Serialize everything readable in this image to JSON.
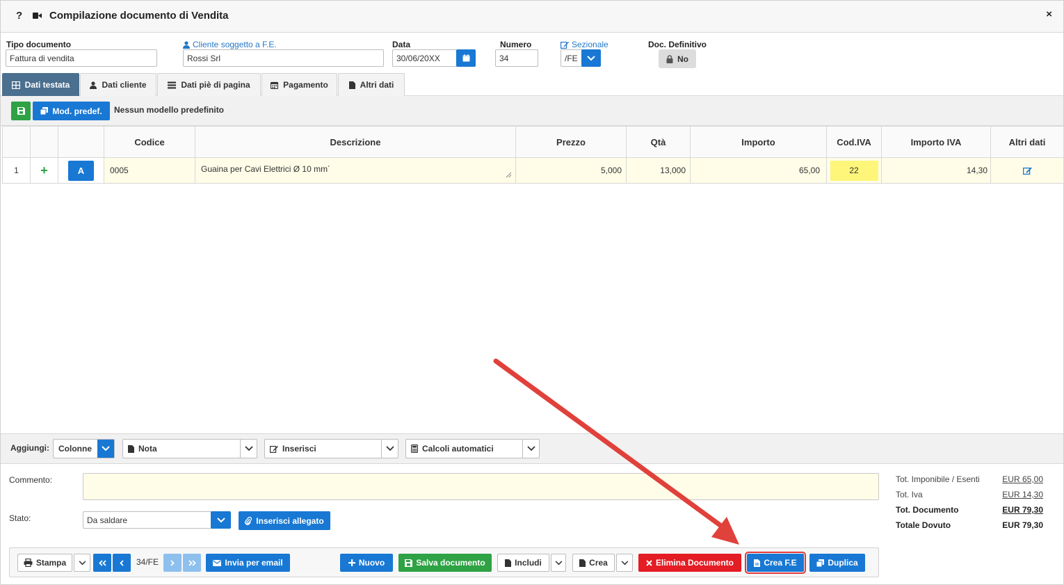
{
  "window": {
    "help": "?",
    "title": "Compilazione documento di Vendita",
    "close": "×"
  },
  "header": {
    "tipo_documento": {
      "label": "Tipo documento",
      "value": "Fattura di vendita"
    },
    "cliente": {
      "label": "Cliente soggetto a F.E.",
      "value": "Rossi Srl"
    },
    "data": {
      "label": "Data",
      "value": "30/06/20XX"
    },
    "numero": {
      "label": "Numero",
      "value": "34"
    },
    "sezionale": {
      "label": "Sezionale",
      "value": "/FE"
    },
    "doc_definitivo": {
      "label": "Doc. Definitivo",
      "value": "No"
    }
  },
  "tabs": [
    {
      "label": "Dati testata",
      "icon": "grid-icon",
      "active": true
    },
    {
      "label": "Dati cliente",
      "icon": "user-icon"
    },
    {
      "label": "Dati piè di pagina",
      "icon": "list-icon"
    },
    {
      "label": "Pagamento",
      "icon": "calendar-icon"
    },
    {
      "label": "Altri dati",
      "icon": "file-icon"
    }
  ],
  "subbar": {
    "mod_predef": "Mod. predef.",
    "modello": "Nessun modello predefinito"
  },
  "grid": {
    "columns": [
      "",
      "",
      "",
      "Codice",
      "Descrizione",
      "Prezzo",
      "Qtà",
      "Importo",
      "Cod.IVA",
      "Importo IVA",
      "Altri dati"
    ],
    "rows": [
      {
        "n": "1",
        "add": "+",
        "type": "A",
        "codice": "0005",
        "descrizione": "Guaina per Cavi Elettrici Ø 10 mm´",
        "prezzo": "5,000",
        "qta": "13,000",
        "importo": "65,00",
        "cod_iva": "22",
        "importo_iva": "14,30"
      }
    ]
  },
  "addbar": {
    "label": "Aggiungi:",
    "colonne": "Colonne",
    "nota": "Nota",
    "inserisci": "Inserisci",
    "calcoli": "Calcoli automatici"
  },
  "footer": {
    "commento_label": "Commento:",
    "stato_label": "Stato:",
    "stato_value": "Da saldare",
    "inserisci_allegato": "Inserisci allegato"
  },
  "totals": [
    {
      "label": "Tot. Imponibile / Esenti",
      "value": "EUR 65,00"
    },
    {
      "label": "Tot. Iva",
      "value": "EUR 14,30"
    },
    {
      "label": "Tot. Documento",
      "value": "EUR 79,30"
    },
    {
      "label": "Totale Dovuto",
      "value": "EUR 79,30"
    }
  ],
  "actions": {
    "stampa": "Stampa",
    "doc_number": "34/FE",
    "invia_email": "Invia per email",
    "nuovo": "Nuovo",
    "salva": "Salva documento",
    "includi": "Includi",
    "crea": "Crea",
    "elimina": "Elimina Documento",
    "crea_fe": "Crea F.E",
    "duplica": "Duplica"
  },
  "colors": {
    "primary": "#1878d4",
    "success": "#2ea244",
    "danger": "#e41c24",
    "tab_active": "#4b6f8e",
    "row_highlight": "#fffde8",
    "iva_highlight": "#fdf67a",
    "annotation_arrow": "#e0413b"
  }
}
